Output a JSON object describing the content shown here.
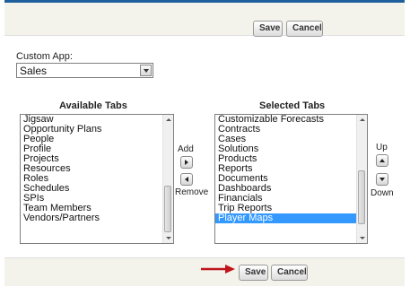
{
  "top_bar": {
    "save_label": "Save",
    "cancel_label": "Cancel"
  },
  "custom_app": {
    "label": "Custom App:",
    "selected": "Sales"
  },
  "available_tabs": {
    "heading": "Available Tabs",
    "items": [
      "Jigsaw",
      "Opportunity Plans",
      "People",
      "Profile",
      "Projects",
      "Resources",
      "Roles",
      "Schedules",
      "SPIs",
      "Team Members",
      "Vendors/Partners"
    ]
  },
  "selected_tabs": {
    "heading": "Selected Tabs",
    "items": [
      "Customizable Forecasts",
      "Contracts",
      "Cases",
      "Solutions",
      "Products",
      "Reports",
      "Documents",
      "Dashboards",
      "Financials",
      "Trip Reports",
      "Player Maps"
    ],
    "highlighted": "Player Maps"
  },
  "move_controls": {
    "add_label": "Add",
    "remove_label": "Remove"
  },
  "order_controls": {
    "up_label": "Up",
    "down_label": "Down"
  },
  "bottom_bar": {
    "save_label": "Save",
    "cancel_label": "Cancel"
  },
  "colors": {
    "accent_border": "#1f5f9e",
    "selection": "#3399ff",
    "annotation_arrow": "#c0141b"
  },
  "annotation": {
    "icon": "red-arrow-icon"
  }
}
